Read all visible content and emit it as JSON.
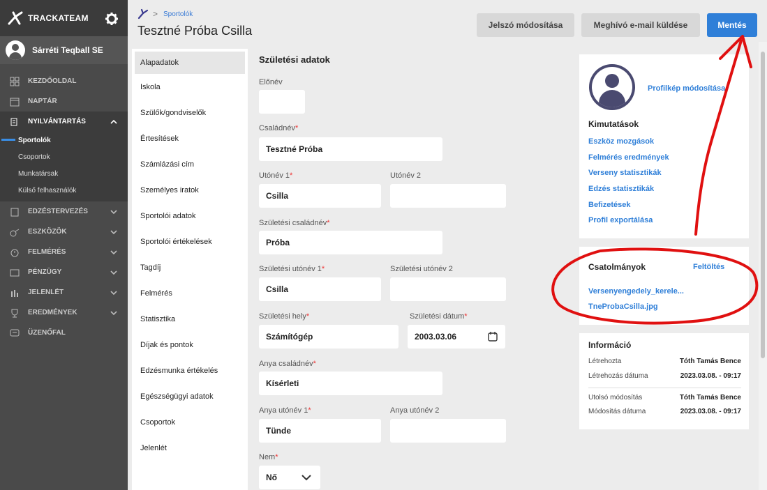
{
  "brand": {
    "name": "TRACKATEAM"
  },
  "club": {
    "name": "Sárréti Teqball SE"
  },
  "nav": {
    "items": [
      {
        "label": "KEZDŐOLDAL"
      },
      {
        "label": "NAPTÁR"
      },
      {
        "label": "NYILVÁNTARTÁS"
      },
      {
        "label": "EDZÉSTERVEZÉS"
      },
      {
        "label": "ESZKÖZÖK"
      },
      {
        "label": "FELMÉRÉS"
      },
      {
        "label": "PÉNZÜGY"
      },
      {
        "label": "JELENLÉT"
      },
      {
        "label": "EREDMÉNYEK"
      },
      {
        "label": "ÜZENŐFAL"
      }
    ],
    "sub_items": [
      {
        "label": "Sportolók"
      },
      {
        "label": "Csoportok"
      },
      {
        "label": "Munkatársak"
      },
      {
        "label": "Külső felhasználók"
      }
    ]
  },
  "header": {
    "breadcrumb": "Sportolók",
    "title": "Tesztné Próba Csilla",
    "btn_password": "Jelszó módosítása",
    "btn_invite": "Meghívó e-mail küldése",
    "btn_save": "Mentés"
  },
  "tabs": [
    {
      "label": "Alapadatok"
    },
    {
      "label": "Iskola"
    },
    {
      "label": "Szülők/gondviselők"
    },
    {
      "label": "Értesítések"
    },
    {
      "label": "Számlázási cím"
    },
    {
      "label": "Személyes iratok"
    },
    {
      "label": "Sportolói adatok"
    },
    {
      "label": "Sportolói értékelések"
    },
    {
      "label": "Tagdíj"
    },
    {
      "label": "Felmérés"
    },
    {
      "label": "Statisztika"
    },
    {
      "label": "Díjak és pontok"
    },
    {
      "label": "Edzésmunka értékelés"
    },
    {
      "label": "Egészségügyi adatok"
    },
    {
      "label": "Csoportok"
    },
    {
      "label": "Jelenlét"
    }
  ],
  "form": {
    "section_title": "Születési adatok",
    "elonev": {
      "label": "Előnév",
      "value": ""
    },
    "csaladnev": {
      "label": "Családnév",
      "value": "Tesztné Próba"
    },
    "utonev1": {
      "label": "Utónév 1",
      "value": "Csilla"
    },
    "utonev2": {
      "label": "Utónév 2",
      "value": ""
    },
    "szul_csaladnev": {
      "label": "Születési családnév",
      "value": "Próba"
    },
    "szul_utonev1": {
      "label": "Születési utónév 1",
      "value": "Csilla"
    },
    "szul_utonev2": {
      "label": "Születési utónév 2",
      "value": ""
    },
    "szul_hely": {
      "label": "Születési hely",
      "value": "Számítógép"
    },
    "szul_datum": {
      "label": "Születési dátum",
      "value": "2003.03.06"
    },
    "anya_csaladnev": {
      "label": "Anya családnév",
      "value": "Kísérleti"
    },
    "anya_utonev1": {
      "label": "Anya utónév 1",
      "value": "Tünde"
    },
    "anya_utonev2": {
      "label": "Anya utónév 2",
      "value": ""
    },
    "nem": {
      "label": "Nem",
      "value": "Nő"
    },
    "required_mark": "*"
  },
  "profile": {
    "change_photo": "Profilkép módosítása",
    "stats_title": "Kimutatások",
    "links": [
      "Eszköz mozgások",
      "Felmérés eredmények",
      "Verseny statisztikák",
      "Edzés statisztikák",
      "Befizetések",
      "Profil exportálása"
    ]
  },
  "attachments": {
    "title": "Csatolmányok",
    "upload": "Feltöltés",
    "files": [
      "Versenyengedely_kerele...",
      "TneProbaCsilla.jpg"
    ]
  },
  "info": {
    "title": "Információ",
    "created_by_label": "Létrehozta",
    "created_by": "Tóth Tamás Bence",
    "created_at_label": "Létrehozás dátuma",
    "created_at": "2023.03.08. - 09:17",
    "modified_by_label": "Utolsó módosítás",
    "modified_by": "Tóth Tamás Bence",
    "modified_at_label": "Módosítás dátuma",
    "modified_at": "2023.03.08. - 09:17"
  },
  "colors": {
    "accent": "#2f7fd8",
    "sidebar": "#4a4a4a",
    "annotation": "#e01010"
  }
}
